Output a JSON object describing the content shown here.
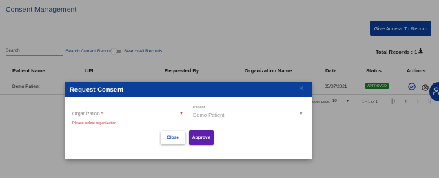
{
  "page": {
    "title": "Consent Management",
    "give_access_label": "Give Access To Record",
    "search_placeholder": "Search",
    "scope_current": "Search Current Records",
    "scope_all": "Search All Records",
    "total_records": "Total Records : 1"
  },
  "table": {
    "columns": [
      "Patient Name",
      "UPI",
      "Requested By",
      "Organization Name",
      "Date",
      "Status",
      "Actions"
    ],
    "rows": [
      {
        "patient_name": "Demo Patient",
        "date": "05/07/2021",
        "status": "APPROVED"
      }
    ]
  },
  "pagination": {
    "rows_per_page_label": "s per page:",
    "rows_per_page": "10",
    "range": "1 – 1 of 1"
  },
  "icons": {
    "download": "download-icon",
    "approve": "check-circle-icon",
    "reject": "x-circle-icon",
    "first": "first-page-icon",
    "prev": "chevron-left-icon",
    "next": "chevron-right-icon",
    "last": "last-page-icon"
  },
  "modal": {
    "title": "Request Consent",
    "close_icon": "×",
    "organization_label": "Organization",
    "required_mark": "*",
    "organization_error": "Please select organization",
    "patient_label": "Patient",
    "patient_value": "Demo Patient",
    "close_label": "Close",
    "approve_label": "Approve"
  },
  "colors": {
    "primary": "#0b3f9c",
    "approve": "#5e1fb0",
    "error": "#d32f2f",
    "status_approved": "#1b7f2a"
  }
}
